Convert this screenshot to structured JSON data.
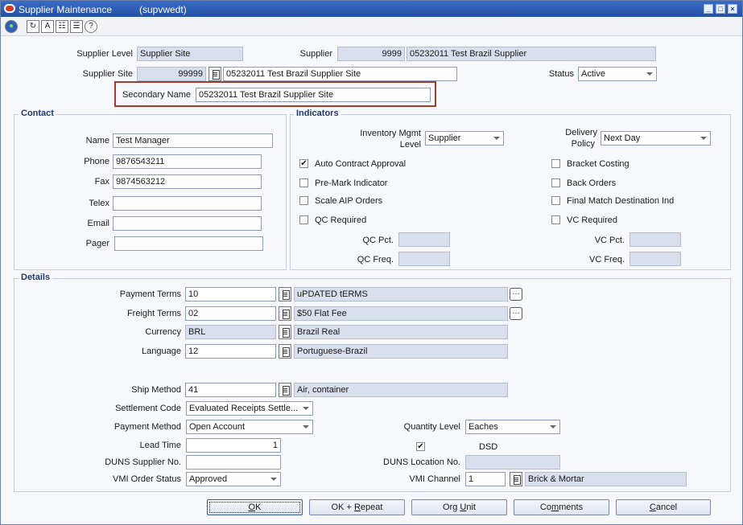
{
  "window": {
    "title": "Supplier Maintenance",
    "form_code": "(supvwedt)",
    "controls": [
      "_",
      "□",
      "×"
    ]
  },
  "toolbar": {
    "icons": [
      "globe-icon",
      "refresh-icon",
      "spellcheck-icon",
      "clipboard-icon",
      "notes-icon",
      "help-icon"
    ],
    "glyphs": [
      "●",
      "↻",
      "A",
      "☷",
      "☰",
      "?"
    ]
  },
  "header": {
    "supplier_level_label": "Supplier Level",
    "supplier_level_value": "Supplier Site",
    "supplier_label": "Supplier",
    "supplier_number": "9999",
    "supplier_name": "05232011 Test Brazil Supplier",
    "supplier_site_label": "Supplier Site",
    "supplier_site_number": "99999",
    "supplier_site_name": "05232011 Test Brazil Supplier Site",
    "status_label": "Status",
    "status_value": "Active",
    "secondary_name_label": "Secondary Name",
    "secondary_name_value": "05232011 Test Brazil Supplier Site"
  },
  "contact": {
    "title": "Contact",
    "name_label": "Name",
    "name_value": "Test Manager",
    "phone_label": "Phone",
    "phone_value": "9876543211",
    "fax_label": "Fax",
    "fax_value": "9874563212",
    "telex_label": "Telex",
    "telex_value": "",
    "email_label": "Email",
    "email_value": "",
    "pager_label": "Pager",
    "pager_value": ""
  },
  "indicators": {
    "title": "Indicators",
    "inventory_mgmt_label_1": "Inventory Mgmt",
    "inventory_mgmt_label_2": "Level",
    "inventory_mgmt_value": "Supplier",
    "delivery_policy_label_1": "Delivery",
    "delivery_policy_label_2": "Policy",
    "delivery_policy_value": "Next Day",
    "checks": {
      "auto_contract_approval": {
        "label": "Auto Contract Approval",
        "checked": true
      },
      "pre_mark_indicator": {
        "label": "Pre-Mark Indicator",
        "checked": false
      },
      "scale_aip_orders": {
        "label": "Scale AIP Orders",
        "checked": false
      },
      "qc_required": {
        "label": "QC Required",
        "checked": false
      },
      "bracket_costing": {
        "label": "Bracket Costing",
        "checked": false
      },
      "back_orders": {
        "label": "Back Orders",
        "checked": false
      },
      "final_match_destination_ind": {
        "label": "Final Match Destination Ind",
        "checked": false
      },
      "vc_required": {
        "label": "VC Required",
        "checked": false
      }
    },
    "qc_pct_label": "QC Pct.",
    "qc_pct_value": "",
    "qc_freq_label": "QC Freq.",
    "qc_freq_value": "",
    "vc_pct_label": "VC Pct.",
    "vc_pct_value": "",
    "vc_freq_label": "VC Freq.",
    "vc_freq_value": ""
  },
  "details": {
    "title": "Details",
    "payment_terms_label": "Payment Terms",
    "payment_terms_code": "10",
    "payment_terms_desc": "uPDATED tERMS",
    "freight_terms_label": "Freight Terms",
    "freight_terms_code": "02",
    "freight_terms_desc": "$50 Flat Fee",
    "currency_label": "Currency",
    "currency_code": "BRL",
    "currency_desc": "Brazil Real",
    "language_label": "Language",
    "language_code": "12",
    "language_desc": "Portuguese-Brazil",
    "ship_method_label": "Ship Method",
    "ship_method_code": "41",
    "ship_method_desc": "Air, container",
    "settlement_code_label": "Settlement Code",
    "settlement_code_value": "Evaluated Receipts Settle...",
    "payment_method_label": "Payment Method",
    "payment_method_value": "Open Account",
    "lead_time_label": "Lead Time",
    "lead_time_value": "1",
    "duns_supplier_label": "DUNS Supplier No.",
    "duns_supplier_value": "",
    "vmi_order_status_label": "VMI Order Status",
    "vmi_order_status_value": "Approved",
    "quantity_level_label": "Quantity Level",
    "quantity_level_value": "Eaches",
    "dsd_label": "DSD",
    "dsd_checked": true,
    "duns_location_label": "DUNS Location No.",
    "duns_location_value": "",
    "vmi_channel_label": "VMI Channel",
    "vmi_channel_code": "1",
    "vmi_channel_desc": "Brick & Mortar"
  },
  "buttons": {
    "ok": {
      "pre": "",
      "key": "O",
      "post": "K"
    },
    "ok_repeat": {
      "pre": "OK + ",
      "key": "R",
      "post": "epeat"
    },
    "org_unit": {
      "pre": "Org ",
      "key": "U",
      "post": "nit"
    },
    "comments": {
      "pre": "Co",
      "key": "m",
      "post": "ments"
    },
    "cancel": {
      "pre": "",
      "key": "C",
      "post": "ancel"
    }
  }
}
